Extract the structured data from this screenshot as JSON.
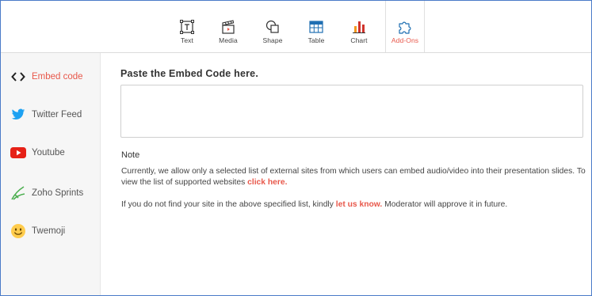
{
  "toolbar": {
    "items": [
      {
        "label": "Text",
        "icon": "text-box-icon"
      },
      {
        "label": "Media",
        "icon": "clapperboard-icon"
      },
      {
        "label": "Shape",
        "icon": "shape-icon"
      },
      {
        "label": "Table",
        "icon": "table-icon"
      },
      {
        "label": "Chart",
        "icon": "bar-chart-icon"
      },
      {
        "label": "Add-Ons",
        "icon": "puzzle-icon"
      }
    ],
    "active": "Add-Ons"
  },
  "sidebar": {
    "items": [
      {
        "label": "Embed code",
        "icon": "code-brackets-icon"
      },
      {
        "label": "Twitter Feed",
        "icon": "twitter-bird-icon"
      },
      {
        "label": "Youtube",
        "icon": "youtube-play-icon"
      },
      {
        "label": "Zoho Sprints",
        "icon": "zoho-sprints-icon"
      },
      {
        "label": "Twemoji",
        "icon": "smiley-emoji-icon"
      }
    ],
    "active": "Embed code"
  },
  "main": {
    "heading": "Paste the Embed Code here.",
    "embed_value": "",
    "note_title": "Note",
    "para1_text": "Currently, we allow only a selected list of external sites from which users can embed audio/video into their presentation slides. To view the list of supported websites ",
    "para1_link": "click here.",
    "para2_text_before": "If you do not find your site in the above specified list, kindly ",
    "para2_link": "let us know.",
    "para2_text_after": " Moderator will approve it in future."
  },
  "colors": {
    "accent": "#e8584b",
    "frame_border": "#4a7bc8",
    "sidebar_bg": "#f6f6f6",
    "twitter": "#1da1f2",
    "youtube": "#e62117",
    "table": "#1f6fb2",
    "chart_orange": "#f29a1f",
    "chart_red": "#d0342c"
  }
}
